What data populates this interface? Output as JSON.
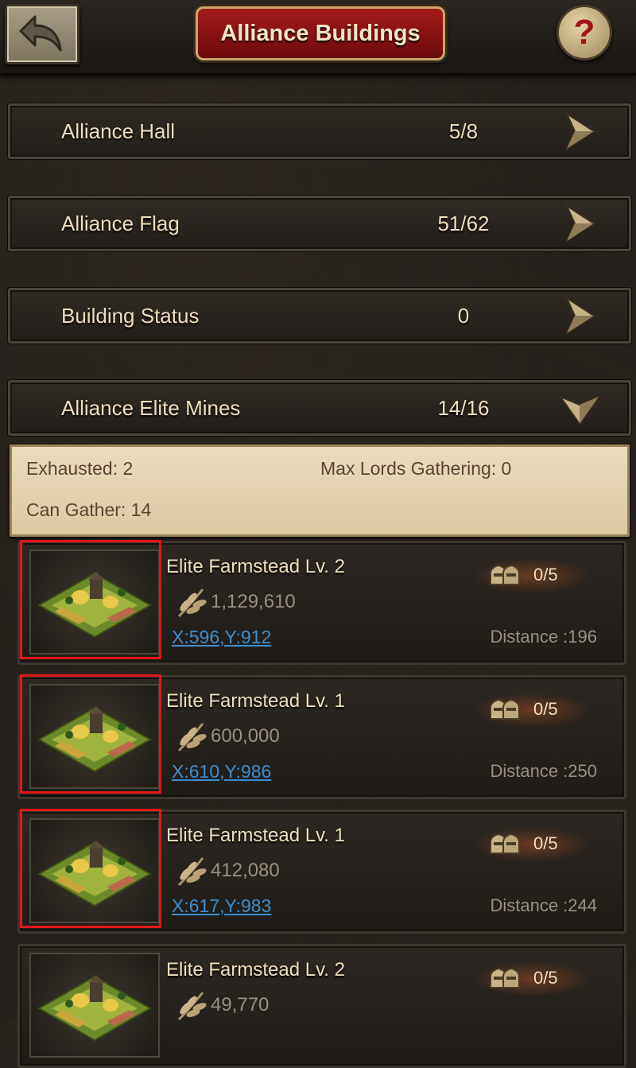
{
  "header": {
    "title": "Alliance Buildings",
    "back_icon": "back-arrow-icon",
    "help_icon": "question-mark-icon",
    "help_label": "?"
  },
  "categories": [
    {
      "label": "Alliance Hall",
      "value": "5/8",
      "arrow": "chevron-right"
    },
    {
      "label": "Alliance Flag",
      "value": "51/62",
      "arrow": "chevron-right"
    },
    {
      "label": "Building Status",
      "value": "0",
      "arrow": "chevron-right"
    },
    {
      "label": "Alliance Elite Mines",
      "value": "14/16",
      "arrow": "chevron-down"
    }
  ],
  "info": {
    "exhausted": "Exhausted: 2",
    "max_lords": "Max Lords Gathering: 0",
    "can_gather": "Can Gather: 14"
  },
  "mines": [
    {
      "name": "Elite Farmstead Lv. 2",
      "amount": "1,129,610",
      "coords": "X:596,Y:912",
      "distance": "Distance :196",
      "gathering": "0/5",
      "highlighted": true
    },
    {
      "name": "Elite Farmstead Lv. 1",
      "amount": "600,000",
      "coords": "X:610,Y:986",
      "distance": "Distance :250",
      "gathering": "0/5",
      "highlighted": true
    },
    {
      "name": "Elite Farmstead Lv. 1",
      "amount": "412,080",
      "coords": "X:617,Y:983",
      "distance": "Distance :244",
      "gathering": "0/5",
      "highlighted": true
    },
    {
      "name": "Elite Farmstead Lv. 2",
      "amount": "49,770",
      "coords": "",
      "distance": "",
      "gathering": "0/5",
      "highlighted": false
    }
  ],
  "colors": {
    "title_plate": "#8c1212",
    "text_cream": "#f0dfbd",
    "link_blue": "#3e8ccc",
    "highlight_red": "#e0161b",
    "info_panel": "#e3d3b0"
  }
}
